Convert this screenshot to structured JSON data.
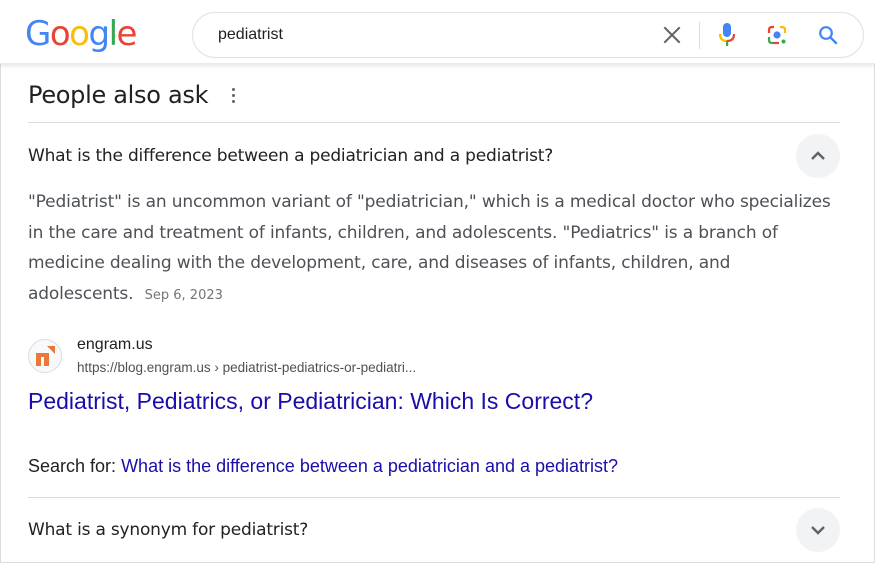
{
  "header": {
    "logo": {
      "letters": [
        {
          "ch": "G",
          "color": "#4285F4"
        },
        {
          "ch": "o",
          "color": "#EA4335"
        },
        {
          "ch": "o",
          "color": "#FBBC05"
        },
        {
          "ch": "g",
          "color": "#4285F4"
        },
        {
          "ch": "l",
          "color": "#34A853"
        },
        {
          "ch": "e",
          "color": "#EA4335"
        }
      ]
    },
    "search": {
      "value": "pediatrist",
      "clear_icon": "close-icon",
      "voice_icon": "mic-icon",
      "lens_icon": "google-lens-icon",
      "search_icon": "search-icon"
    }
  },
  "people_also_ask": {
    "title": "People also ask",
    "more_icon": "more-vert-icon",
    "questions": [
      {
        "question": "What is the difference between a pediatrician and a pediatrist?",
        "expanded": true,
        "chevron_icon": "chevron-up-icon",
        "answer": "\"Pediatrist\" is an uncommon variant of \"pediatrician,\" which is a medical doctor who specializes in the care and treatment of infants, children, and adolescents. \"Pediatrics\" is a branch of medicine dealing with the development, care, and diseases of infants, children, and adolescents.",
        "date": "Sep 6, 2023",
        "source": {
          "site_name": "engram.us",
          "url": "https://blog.engram.us › pediatrist-pediatrics-or-pediatri...",
          "favicon_color": "#E8793A",
          "title": "Pediatrist, Pediatrics, or Pediatrician: Which Is Correct?"
        },
        "search_for_label": "Search for:",
        "search_for_query": "What is the difference between a pediatrician and a pediatrist?"
      },
      {
        "question": "What is a synonym for pediatrist?",
        "expanded": false,
        "chevron_icon": "chevron-down-icon"
      }
    ]
  },
  "colors": {
    "link": "#1a0dab",
    "text_primary": "#202124",
    "text_secondary": "#4d5156",
    "divider": "#dadce0"
  }
}
